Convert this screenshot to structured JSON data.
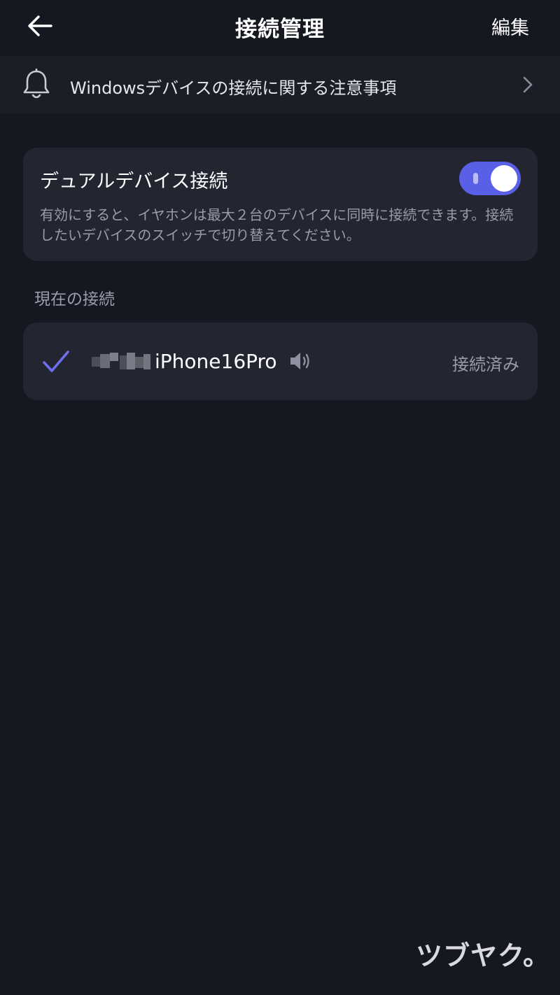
{
  "header": {
    "title": "接続管理",
    "edit_label": "編集"
  },
  "notice": {
    "text": "Windowsデバイスの接続に関する注意事項"
  },
  "dual_connection": {
    "title": "デュアルデバイス接続",
    "enabled": true,
    "description": "有効にすると、イヤホンは最大２台のデバイスに同時に接続できます。接続したいデバイスのスイッチで切り替えてください。"
  },
  "current_section": {
    "heading": "現在の接続",
    "device": {
      "name": "iPhone16Pro",
      "status": "接続済み",
      "selected": true
    }
  },
  "watermark": {
    "text": "ツブヤク。"
  },
  "colors": {
    "background": "#161821",
    "card": "#232531",
    "accent": "#5a5fe8",
    "muted_text": "#9a9cab"
  },
  "icons": [
    "back-arrow-icon",
    "bell-icon",
    "chevron-right-icon",
    "checkmark-icon",
    "speaker-icon"
  ]
}
